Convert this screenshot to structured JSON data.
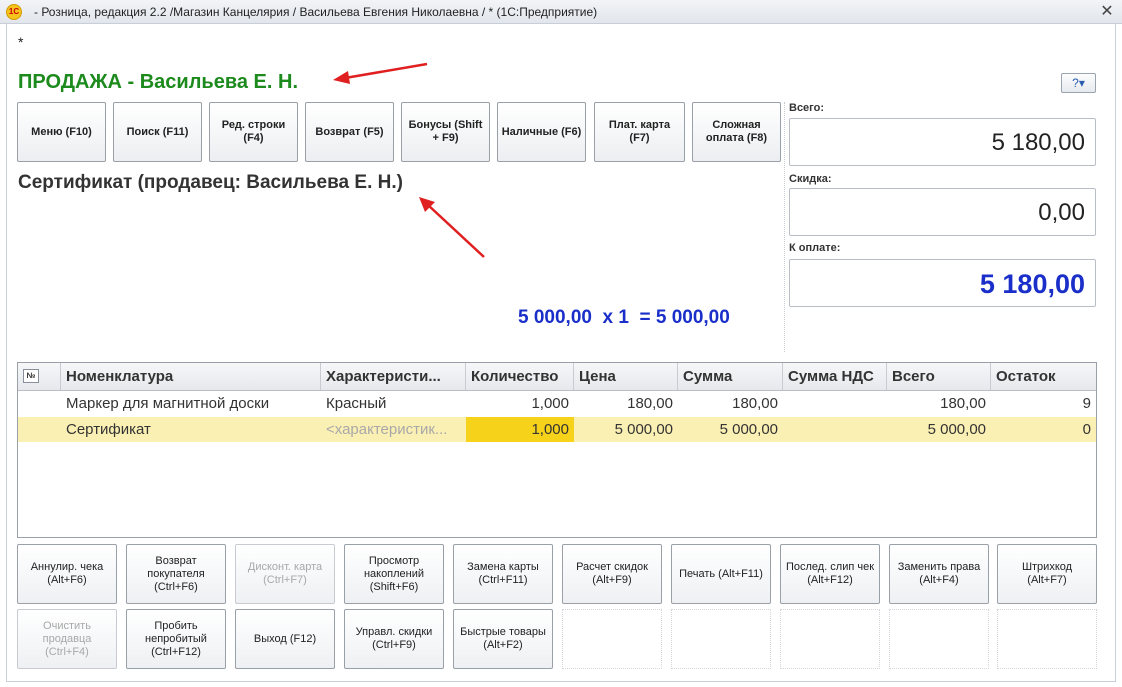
{
  "window": {
    "title": "- Розница, редакция 2.2 /Магазин Канцелярия / Васильева Евгения Николаевна  / * (1С:Предприятие)",
    "app_icon": "1С",
    "close_glyph": "✕"
  },
  "modified_marker": "*",
  "sale_title": "ПРОДАЖА - Васильева Е. Н.",
  "help_glyph": "?▾",
  "function_buttons": [
    {
      "label": "Меню (F10)"
    },
    {
      "label": "Поиск (F11)"
    },
    {
      "label": "Ред. строки (F4)"
    },
    {
      "label": "Возврат (F5)"
    },
    {
      "label": "Бонусы (Shift + F9)"
    },
    {
      "label": "Наличные (F6)"
    },
    {
      "label": "Плат. карта (F7)"
    },
    {
      "label": "Сложная оплата (F8)"
    }
  ],
  "current_item": "Сертификат (продавец: Васильева Е. Н.)",
  "calculation": "5 000,00  x 1  = 5 000,00",
  "totals": {
    "total_label": "Всего:",
    "total_value": "5 180,00",
    "discount_label": "Скидка:",
    "discount_value": "0,00",
    "to_pay_label": "К оплате:",
    "to_pay_value": "5 180,00"
  },
  "table": {
    "number_icon": "№",
    "columns": [
      "Номенклатура",
      "Характеристи...",
      "Количество",
      "Цена",
      "Сумма",
      "Сумма НДС",
      "Всего",
      "Остаток"
    ],
    "rows": [
      {
        "name": "Маркер для магнитной доски",
        "characteristic": "Красный",
        "quantity": "1,000",
        "price": "180,00",
        "sum": "180,00",
        "vat": "",
        "total": "180,00",
        "remainder": "9"
      },
      {
        "name": "Сертификат",
        "characteristic": "<характеристик...",
        "quantity": "1,000",
        "price": "5 000,00",
        "sum": "5 000,00",
        "vat": "",
        "total": "5 000,00",
        "remainder": "0"
      }
    ]
  },
  "bottom_buttons_row1": [
    {
      "label": "Аннулир. чека (Alt+F6)",
      "enabled": true
    },
    {
      "label": "Возврат покупателя (Ctrl+F6)",
      "enabled": true
    },
    {
      "label": "Дисконт. карта (Ctrl+F7)",
      "enabled": false
    },
    {
      "label": "Просмотр накоплений (Shift+F6)",
      "enabled": true
    },
    {
      "label": "Замена карты (Ctrl+F11)",
      "enabled": true
    },
    {
      "label": "Расчет скидок (Alt+F9)",
      "enabled": true
    },
    {
      "label": "Печать (Alt+F11)",
      "enabled": true
    },
    {
      "label": "Послед. слип чек (Alt+F12)",
      "enabled": true
    },
    {
      "label": "Заменить права (Alt+F4)",
      "enabled": true
    },
    {
      "label": "Штрихкод (Alt+F7)",
      "enabled": true
    }
  ],
  "bottom_buttons_row2": [
    {
      "label": "Очистить продавца (Ctrl+F4)",
      "enabled": false
    },
    {
      "label": "Пробить непробитый (Ctrl+F12)",
      "enabled": true
    },
    {
      "label": "Выход (F12)",
      "enabled": true
    },
    {
      "label": "Управл. скидки (Ctrl+F9)",
      "enabled": true
    },
    {
      "label": "Быстрые товары (Alt+F2)",
      "enabled": true
    }
  ],
  "colors": {
    "sale_title": "#1c8a1c",
    "amount_blue": "#1a2fc9",
    "selected_row": "#fbf0b4",
    "quantity_highlight": "#f7d21a",
    "annotation_arrow": "#e02020"
  }
}
